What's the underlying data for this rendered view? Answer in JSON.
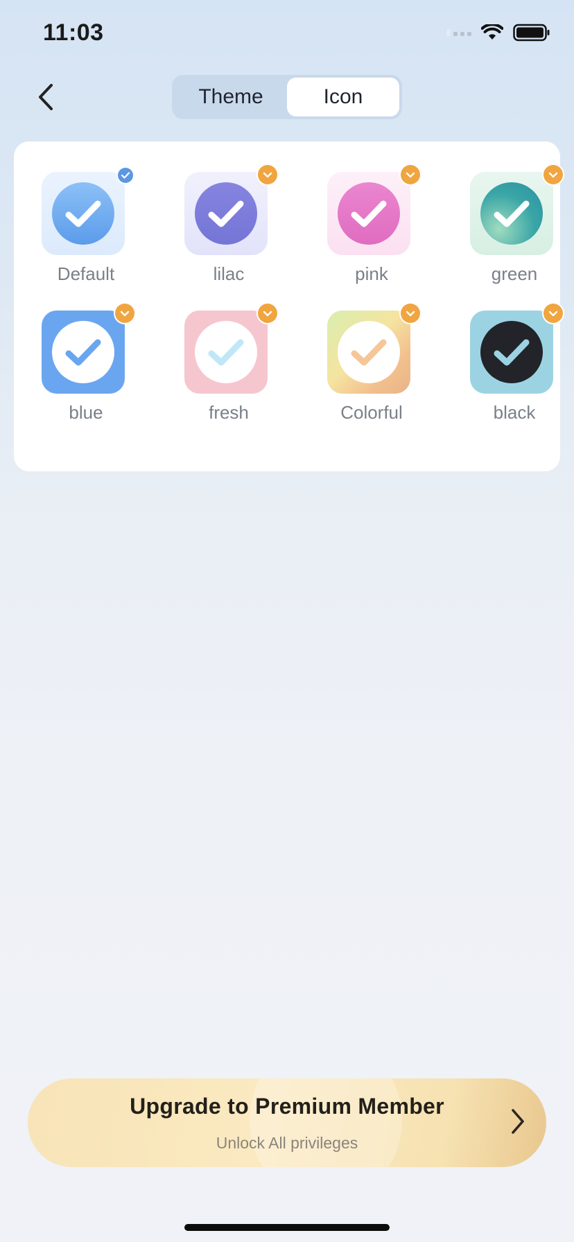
{
  "status_bar": {
    "time": "11:03",
    "icons": [
      "cellular-signal-icon",
      "wifi-icon",
      "battery-icon"
    ]
  },
  "nav": {
    "back_icon": "chevron-left-icon",
    "tabs": [
      {
        "label": "Theme",
        "active": false
      },
      {
        "label": "Icon",
        "active": true
      }
    ]
  },
  "icons": {
    "items": [
      {
        "label": "Default",
        "selected": true,
        "premium": false
      },
      {
        "label": "lilac",
        "selected": false,
        "premium": true
      },
      {
        "label": "pink",
        "selected": false,
        "premium": true
      },
      {
        "label": "green",
        "selected": false,
        "premium": true
      },
      {
        "label": "blue",
        "selected": false,
        "premium": true
      },
      {
        "label": "fresh",
        "selected": false,
        "premium": true
      },
      {
        "label": "Colorful",
        "selected": false,
        "premium": true
      },
      {
        "label": "black",
        "selected": false,
        "premium": true
      }
    ]
  },
  "premium_banner": {
    "title": "Upgrade to Premium Member",
    "subtitle": "Unlock All privileges",
    "arrow_icon": "chevron-right-icon"
  },
  "colors": {
    "accent": "#5d97e2",
    "premium_badge": "#f0a540",
    "banner_gold": "#f7e4b7"
  }
}
